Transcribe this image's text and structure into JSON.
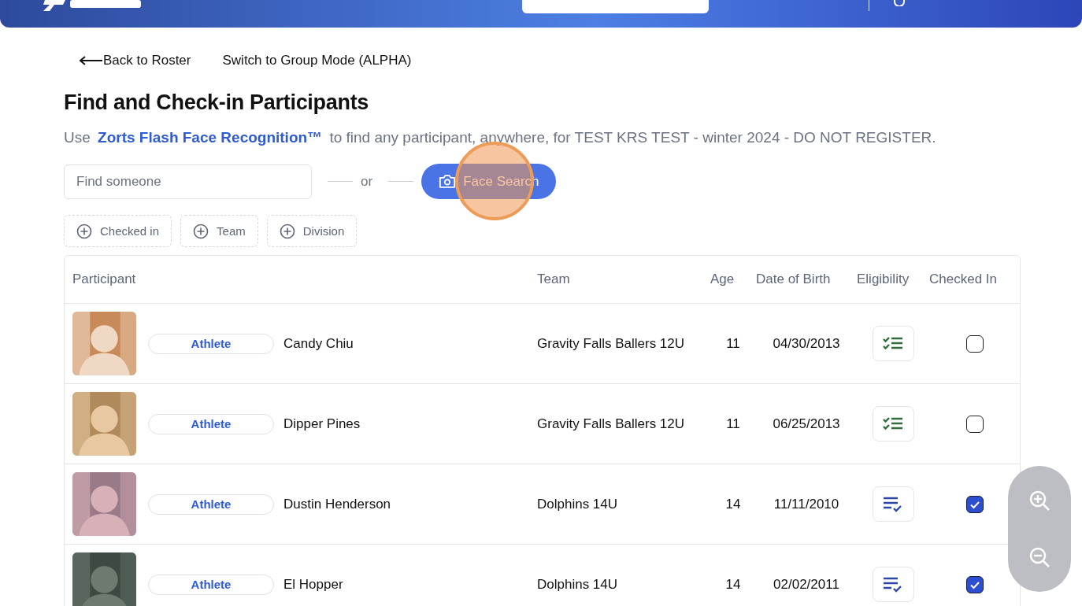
{
  "nav": {
    "back": "Back to Roster",
    "group_mode": "Switch to Group Mode (ALPHA)"
  },
  "title": "Find and Check-in Participants",
  "intro": {
    "before": "Use",
    "link": "Zorts Flash Face Recognition™",
    "after": "to find any participant, anywhere, for TEST KRS TEST - winter 2024 - DO NOT REGISTER."
  },
  "search": {
    "placeholder": "Find someone",
    "separator": "or",
    "face_button": "Face Search"
  },
  "filters": [
    "Checked in",
    "Team",
    "Division"
  ],
  "table": {
    "columns": [
      "Participant",
      "Team",
      "Age",
      "Date of Birth",
      "Eligibility",
      "Checked In"
    ],
    "rows": [
      {
        "role": "Athlete",
        "name": "Candy Chiu",
        "team": "Gravity Falls Ballers 12U",
        "age": "11",
        "dob": "04/30/2013",
        "eligibility": {
          "kind": "complete"
        },
        "checked": false
      },
      {
        "role": "Athlete",
        "name": "Dipper Pines",
        "team": "Gravity Falls Ballers 12U",
        "age": "11",
        "dob": "06/25/2013",
        "eligibility": {
          "kind": "complete"
        },
        "checked": false
      },
      {
        "role": "Athlete",
        "name": "Dustin Henderson",
        "team": "Dolphins 14U",
        "age": "14",
        "dob": "11/11/2010",
        "eligibility": {
          "kind": "partial"
        },
        "checked": true
      },
      {
        "role": "Athlete",
        "name": "El Hopper",
        "team": "Dolphins 14U",
        "age": "14",
        "dob": "02/02/2011",
        "eligibility": {
          "kind": "partial"
        },
        "checked": true
      }
    ]
  }
}
